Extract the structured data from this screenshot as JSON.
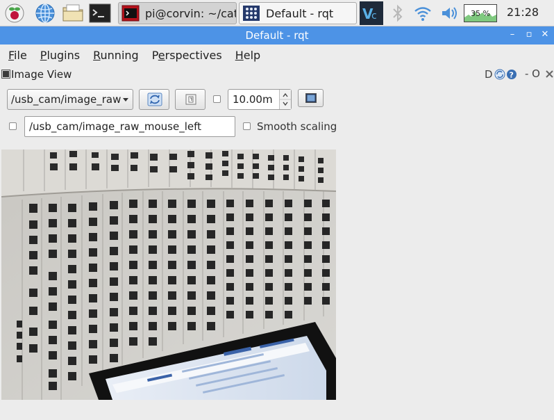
{
  "taskbar": {
    "tasks": [
      {
        "label": "pi@corvin: ~/cat..."
      },
      {
        "label": "Default - rqt"
      }
    ],
    "cpu_label": "35 %",
    "clock": "21:28"
  },
  "window": {
    "title": "Default - rqt",
    "buttons": [
      "–",
      "▫",
      "✕"
    ]
  },
  "menu": {
    "items": [
      {
        "u": "F",
        "rest": "ile"
      },
      {
        "u": "P",
        "rest": "lugins"
      },
      {
        "u": "R",
        "rest": "unning"
      },
      {
        "pre": "P",
        "u": "e",
        "rest": "rspectives"
      },
      {
        "u": "H",
        "rest": "elp"
      }
    ]
  },
  "plugin": {
    "title": "Image View",
    "controls_right": [
      "D",
      "- O"
    ]
  },
  "controls": {
    "topic_selected": "/usb_cam/image_raw",
    "zoom_value": "10.00m",
    "mouse_topic_value": "/usb_cam/image_raw_mouse_left",
    "smooth_scaling_label": "Smooth scaling"
  },
  "colors": {
    "titlebar": "#4d93e6",
    "taskbar": "#ededed",
    "window_bg": "#ececec"
  }
}
